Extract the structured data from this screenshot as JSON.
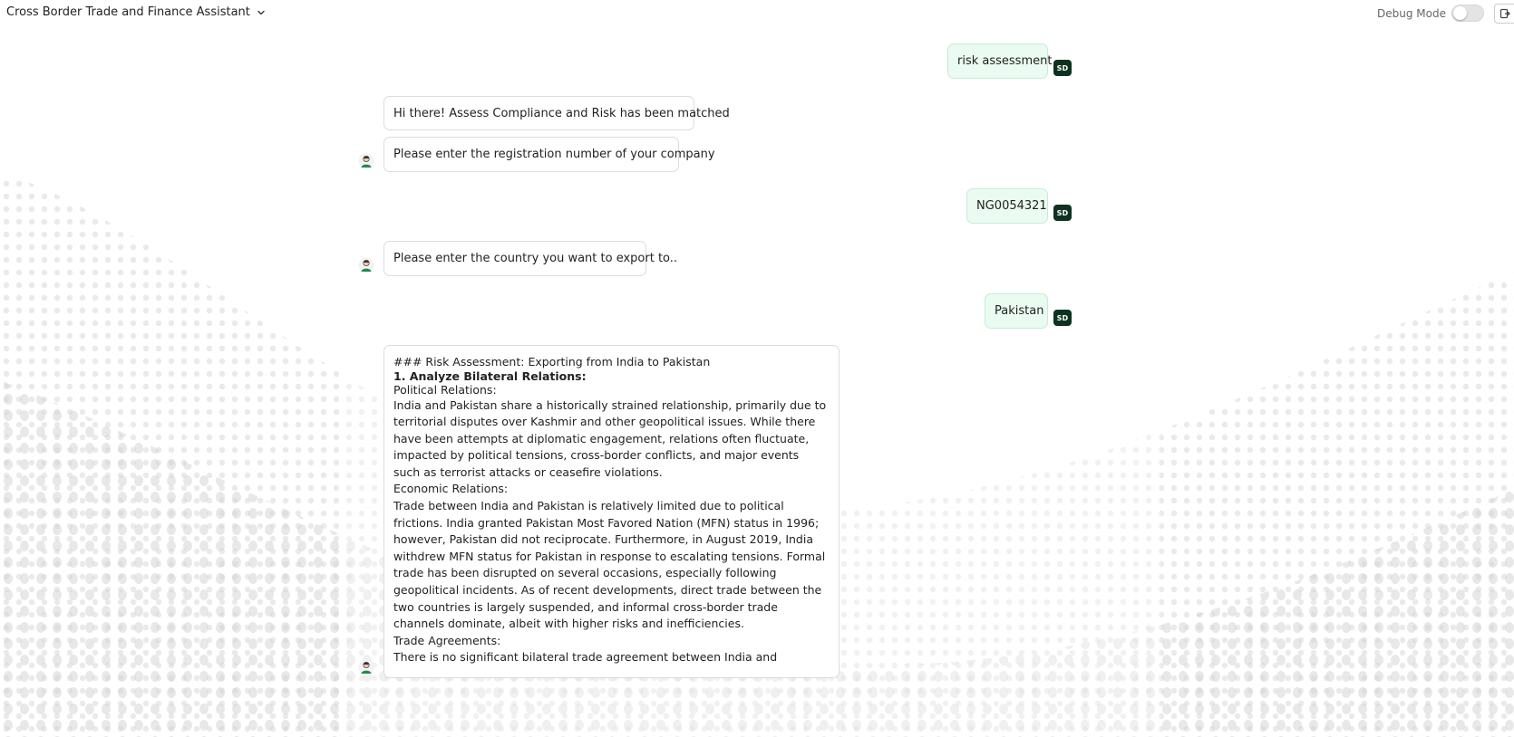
{
  "header": {
    "app_title": "Cross Border Trade and Finance Assistant",
    "debug_label": "Debug Mode"
  },
  "user_initials": "SD",
  "messages": {
    "m1": "risk assessment",
    "m2": "Hi there! Assess Compliance and Risk has been matched",
    "m3": "Please enter the registration number of your company",
    "m4": "NG0054321",
    "m5": "Please enter the country you want to export to..",
    "m6": "Pakistan"
  },
  "report": {
    "heading": "### Risk Assessment: Exporting from India to Pakistan",
    "section1": "1. Analyze Bilateral Relations:",
    "political_label": "Political Relations:",
    "political_text": "India and Pakistan share a historically strained relationship, primarily due to territorial disputes over Kashmir and other geopolitical issues. While there have been attempts at diplomatic engagement, relations often fluctuate, impacted by political tensions, cross-border conflicts, and major events such as terrorist attacks or ceasefire violations.",
    "economic_label": "Economic Relations:",
    "economic_text": "Trade between India and Pakistan is relatively limited due to political frictions. India granted Pakistan Most Favored Nation (MFN) status in 1996; however, Pakistan did not reciprocate. Furthermore, in August 2019, India withdrew MFN status for Pakistan in response to escalating tensions. Formal trade has been disrupted on several occasions, especially following geopolitical incidents. As of recent developments, direct trade between the two countries is largely suspended, and informal cross-border trade channels dominate, albeit with higher risks and inefficiencies.",
    "trade_label": "Trade Agreements:",
    "trade_text": "There is no significant bilateral trade agreement between India and"
  },
  "icons": {
    "title_dropdown": "chevron-down-icon",
    "exit": "exit-icon",
    "bot_avatar": "bot-avatar-icon"
  },
  "colors": {
    "user_bubble_bg": "#eafbf1",
    "user_avatar_bg": "#0d3320"
  }
}
